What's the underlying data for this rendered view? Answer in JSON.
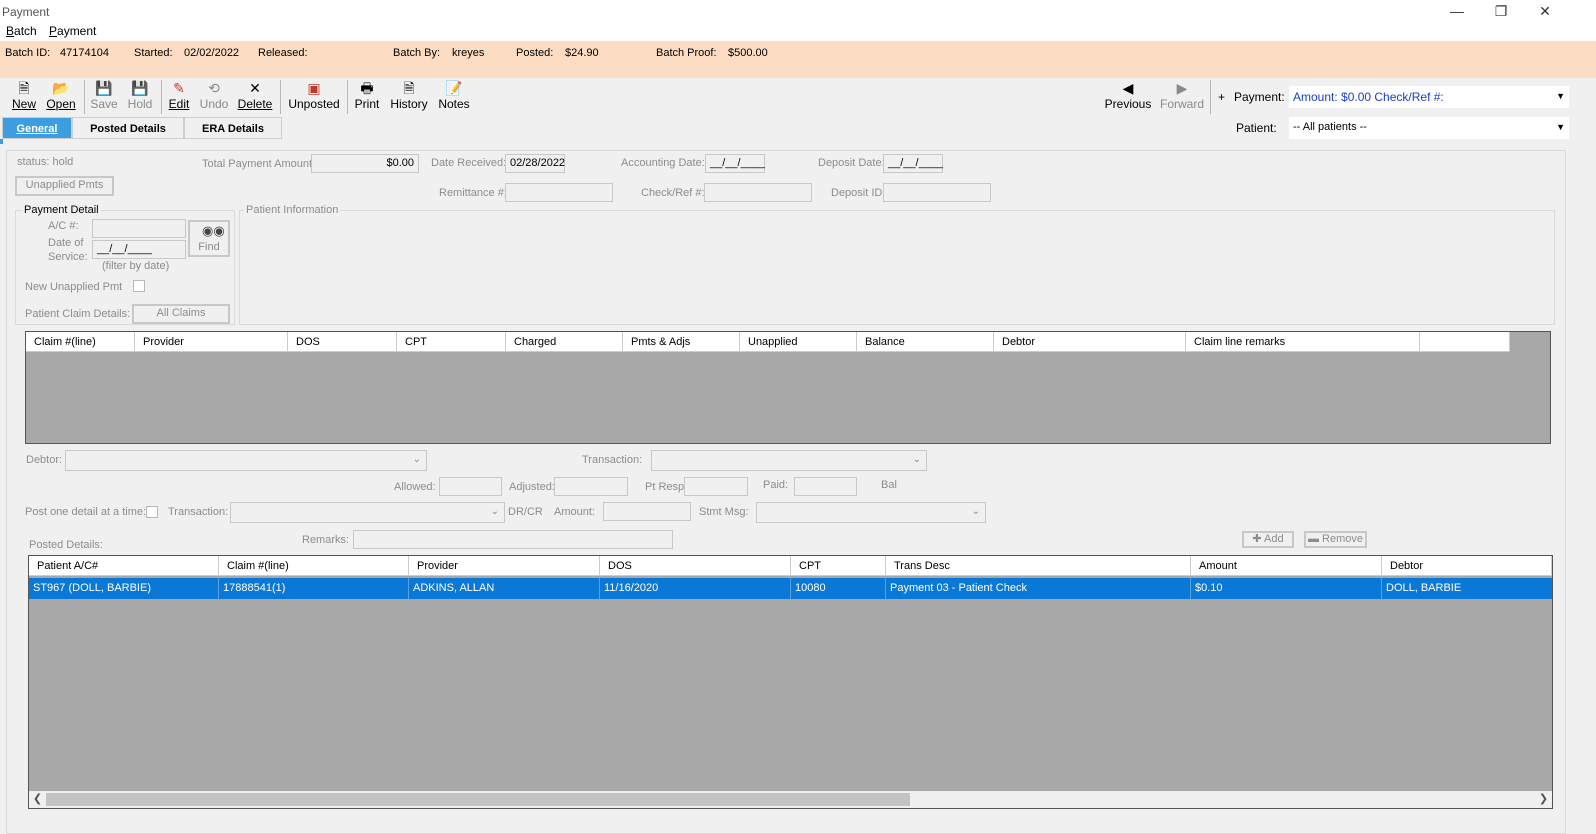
{
  "window": {
    "title": "Payment",
    "min_icon": "minimize-icon",
    "restore_icon": "restore-icon",
    "close_icon": "close-icon"
  },
  "menu": {
    "batch": "Batch",
    "payment": "Payment"
  },
  "batch": {
    "id_label": "Batch ID:",
    "id": "47174104",
    "started_label": "Started:",
    "started": "02/02/2022",
    "released_label": "Released:",
    "released": "",
    "by_label": "Batch By:",
    "by": "kreyes",
    "posted_label": "Posted:",
    "posted": "$24.90",
    "proof_label": "Batch Proof:",
    "proof": "$500.00"
  },
  "toolbar": {
    "new": "New",
    "open": "Open",
    "save": "Save",
    "hold": "Hold",
    "edit": "Edit",
    "undo": "Undo",
    "delete": "Delete",
    "unposted": "Unposted",
    "print": "Print",
    "history": "History",
    "notes": "Notes",
    "previous": "Previous",
    "forward": "Forward",
    "plus": "+",
    "payment_label": "Payment:",
    "payment_value": "Amount: $0.00 Check/Ref #:",
    "patient_label": "Patient:",
    "patient_value": "-- All patients --"
  },
  "tabs": {
    "general": "General",
    "posted": "Posted Details",
    "era": "ERA Details"
  },
  "form": {
    "status": "status:  hold",
    "total_label": "Total Payment Amount:",
    "total": "$0.00",
    "date_received_label": "Date Received:",
    "date_received": "02/28/2022",
    "accounting_label": "Accounting Date:",
    "accounting": "__/__/____",
    "deposit_label": "Deposit Date:",
    "deposit": "__/__/____",
    "unapplied_btn": "Unapplied Pmts",
    "remittance_label": "Remittance #:",
    "checkref_label": "Check/Ref #:",
    "deposit_id_label": "Deposit ID:",
    "payment_detail": "Payment Detail",
    "patient_info": "Patient Information",
    "ac_label": "A/C #:",
    "dos_label1": "Date of",
    "dos_label2": "Service:",
    "dos_value": "__/__/____",
    "filter_hint": "(filter by date)",
    "find": "Find",
    "new_unapplied": "New Unapplied Pmt",
    "claim_details": "Patient Claim Details:",
    "all_claims": "All Claims",
    "debtor_label": "Debtor:",
    "transaction_label": "Transaction:",
    "allowed_label": "Allowed:",
    "adjusted_label": "Adjusted:",
    "ptresp_label": "Pt Resp:",
    "paid_label": "Paid:",
    "bal_label": "Bal",
    "post_one_label": "Post one detail at a time:",
    "transaction2_label": "Transaction:",
    "drcr_label": "DR/CR",
    "amount_label": "Amount:",
    "stmt_label": "Stmt Msg:",
    "posted_details_label": "Posted Details:",
    "remarks_label": "Remarks:",
    "add": "Add",
    "remove": "Remove"
  },
  "claims_grid": {
    "columns": [
      "Claim #(line)",
      "Provider",
      "DOS",
      "CPT",
      "Charged",
      "Pmts & Adjs",
      "Unapplied",
      "Balance",
      "Debtor",
      "Claim line remarks"
    ]
  },
  "posted_grid": {
    "columns": [
      "Patient A/C#",
      "Claim #(line)",
      "Provider",
      "DOS",
      "CPT",
      "Trans Desc",
      "Amount",
      "Debtor"
    ],
    "rows": [
      [
        "ST967 (DOLL, BARBIE)",
        "17888541(1)",
        "ADKINS, ALLAN",
        "11/16/2020",
        "10080",
        "Payment 03 - Patient Check",
        "$0.10",
        "DOLL, BARBIE"
      ]
    ]
  }
}
